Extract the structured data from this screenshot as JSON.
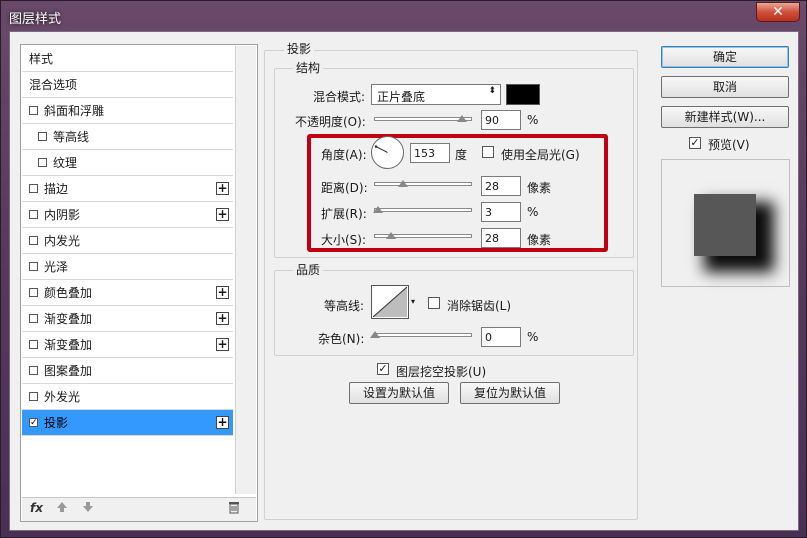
{
  "window": {
    "title": "图层样式",
    "close_label": "✕"
  },
  "left_panel": {
    "items": [
      {
        "label": "样式",
        "checkbox": false,
        "indent": false,
        "plus": false,
        "active": false
      },
      {
        "label": "混合选项",
        "checkbox": false,
        "indent": false,
        "plus": false,
        "active": false
      },
      {
        "label": "斜面和浮雕",
        "checkbox": true,
        "checked": false,
        "indent": false,
        "plus": false,
        "active": false
      },
      {
        "label": "等高线",
        "checkbox": true,
        "checked": false,
        "indent": true,
        "plus": false,
        "active": false
      },
      {
        "label": "纹理",
        "checkbox": true,
        "checked": false,
        "indent": true,
        "plus": false,
        "active": false
      },
      {
        "label": "描边",
        "checkbox": true,
        "checked": false,
        "indent": false,
        "plus": true,
        "active": false
      },
      {
        "label": "内阴影",
        "checkbox": true,
        "checked": false,
        "indent": false,
        "plus": true,
        "active": false
      },
      {
        "label": "内发光",
        "checkbox": true,
        "checked": false,
        "indent": false,
        "plus": false,
        "active": false
      },
      {
        "label": "光泽",
        "checkbox": true,
        "checked": false,
        "indent": false,
        "plus": false,
        "active": false
      },
      {
        "label": "颜色叠加",
        "checkbox": true,
        "checked": false,
        "indent": false,
        "plus": true,
        "active": false
      },
      {
        "label": "渐变叠加",
        "checkbox": true,
        "checked": false,
        "indent": false,
        "plus": true,
        "active": false
      },
      {
        "label": "渐变叠加",
        "checkbox": true,
        "checked": false,
        "indent": false,
        "plus": true,
        "active": false
      },
      {
        "label": "图案叠加",
        "checkbox": true,
        "checked": false,
        "indent": false,
        "plus": false,
        "active": false
      },
      {
        "label": "外发光",
        "checkbox": true,
        "checked": false,
        "indent": false,
        "plus": false,
        "active": false
      },
      {
        "label": "投影",
        "checkbox": true,
        "checked": true,
        "indent": false,
        "plus": true,
        "active": true
      }
    ],
    "footer": {
      "fx_label": "fx",
      "check_mark": "✓",
      "plus_label": "+"
    }
  },
  "drop_shadow": {
    "section_title": "投影",
    "structure": {
      "title": "结构",
      "blend_mode_label": "混合模式:",
      "blend_mode_value": "正片叠底",
      "select_arrow": "⬍",
      "shadow_color": "#000000",
      "opacity_label": "不透明度(O):",
      "opacity_value": "90",
      "opacity_unit": "%",
      "angle_label": "角度(A):",
      "angle_value": "153",
      "angle_unit": "度",
      "global_light_label": "使用全局光(G)",
      "distance_label": "距离(D):",
      "distance_value": "28",
      "distance_unit": "像素",
      "spread_label": "扩展(R):",
      "spread_value": "3",
      "spread_unit": "%",
      "size_label": "大小(S):",
      "size_value": "28",
      "size_unit": "像素"
    },
    "quality": {
      "title": "品质",
      "contour_label": "等高线:",
      "antialias_label": "消除锯齿(L)",
      "noise_label": "杂色(N):",
      "noise_value": "0",
      "noise_unit": "%"
    },
    "knockout_label": "图层挖空投影(U)",
    "set_default_label": "设置为默认值",
    "reset_default_label": "复位为默认值"
  },
  "right_panel": {
    "ok_label": "确定",
    "cancel_label": "取消",
    "new_style_label": "新建样式(W)...",
    "preview_label": "预览(V)",
    "preview_checked": true
  },
  "colors": {
    "highlight": "#3399ff",
    "red_box": "#c00010"
  }
}
